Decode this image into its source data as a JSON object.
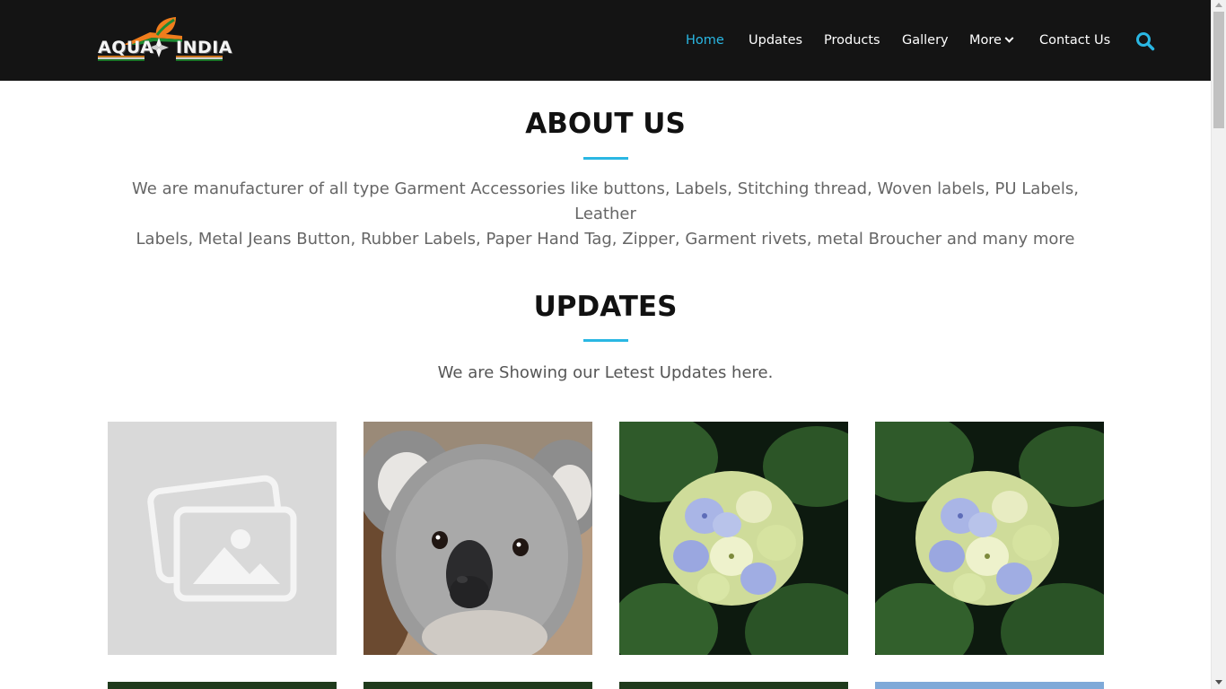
{
  "header": {
    "logo": {
      "left_word": "AQUA",
      "right_word": "INDIA"
    },
    "nav": [
      {
        "label": "Home",
        "active": true
      },
      {
        "label": "Updates",
        "active": false
      },
      {
        "label": "Products",
        "active": false
      },
      {
        "label": "Gallery",
        "active": false
      },
      {
        "label": "More",
        "active": false,
        "has_dropdown": true
      },
      {
        "label": "Contact Us",
        "active": false
      }
    ],
    "search_icon": "search-icon",
    "accent_color": "#2ab7e3",
    "background_color": "#141414"
  },
  "about": {
    "title": "ABOUT US",
    "text_line1": "We are manufacturer of all type Garment Accessories like buttons, Labels, Stitching thread, Woven labels, PU Labels, Leather",
    "text_line2": "Labels, Metal Jeans Button, Rubber Labels, Paper Hand Tag, Zipper, Garment rivets, metal Broucher and many more"
  },
  "updates": {
    "title": "UPDATES",
    "subtitle": "We are Showing our Letest Updates here.",
    "items": [
      {
        "image": "placeholder-image-icon"
      },
      {
        "image": "koala"
      },
      {
        "image": "hydrangea-flower"
      },
      {
        "image": "hydrangea-flower"
      }
    ]
  }
}
